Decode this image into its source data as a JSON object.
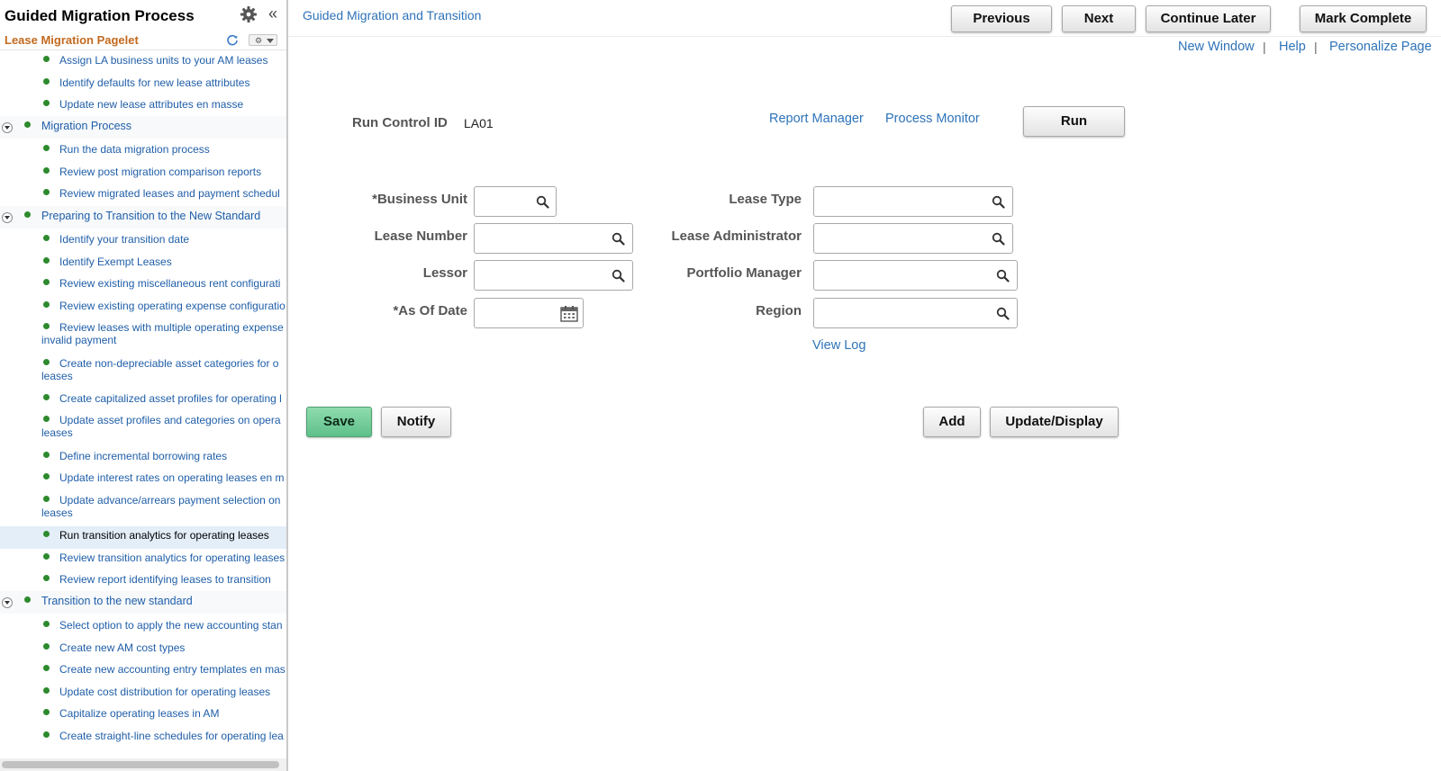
{
  "left_panel": {
    "title": "Guided Migration Process",
    "pagelet_title": "Lease Migration Pagelet",
    "steps": [
      {
        "label": "Assign LA business units to your AM leases"
      },
      {
        "label": "Identify defaults for new lease attributes"
      },
      {
        "label": "Update new lease attributes en masse"
      },
      {
        "label": "Migration Process"
      },
      {
        "label": "Run the data migration process"
      },
      {
        "label": "Review post migration comparison reports"
      },
      {
        "label": "Review migrated leases and payment schedul"
      },
      {
        "label": "Preparing to Transition to the New Standard"
      },
      {
        "label": "Identify your transition date"
      },
      {
        "label": "Identify Exempt Leases"
      },
      {
        "label": "Review existing miscellaneous rent configurati"
      },
      {
        "label": "Review existing operating expense configuratio"
      },
      {
        "label": "Review leases with multiple operating expense invalid payment"
      },
      {
        "label": "Create non-depreciable asset categories for o leases"
      },
      {
        "label": "Create capitalized asset profiles for operating l"
      },
      {
        "label": "Update asset profiles and categories on opera leases"
      },
      {
        "label": "Define incremental borrowing rates"
      },
      {
        "label": "Update interest rates on operating leases en m"
      },
      {
        "label": "Update advance/arrears payment selection on leases"
      },
      {
        "label": "Run transition analytics for operating leases"
      },
      {
        "label": "Review transition analytics for operating leases"
      },
      {
        "label": "Review report identifying leases to transition"
      },
      {
        "label": "Transition to the new standard"
      },
      {
        "label": "Select option to apply the new accounting stan"
      },
      {
        "label": "Create new AM cost types"
      },
      {
        "label": "Create new accounting entry templates en mas"
      },
      {
        "label": "Update cost distribution for operating leases"
      },
      {
        "label": "Capitalize operating leases in AM"
      },
      {
        "label": "Create straight-line schedules for operating lea"
      }
    ]
  },
  "topbar": {
    "breadcrumb": "Guided Migration and Transition",
    "previous": "Previous",
    "next": "Next",
    "continue_later": "Continue Later",
    "mark_complete": "Mark Complete",
    "new_window": "New Window",
    "help": "Help",
    "personalize": "Personalize Page",
    "sep": "|"
  },
  "form": {
    "run_control_label": "Run Control ID",
    "run_control_value": "LA01",
    "report_manager": "Report Manager",
    "process_monitor": "Process Monitor",
    "run": "Run",
    "business_unit": "*Business Unit",
    "lease_number": "Lease Number",
    "lessor": "Lessor",
    "as_of_date": "*As Of Date",
    "lease_type": "Lease Type",
    "lease_administrator": "Lease Administrator",
    "portfolio_manager": "Portfolio Manager",
    "region": "Region",
    "view_log": "View Log"
  },
  "actions": {
    "save": "Save",
    "notify": "Notify",
    "add": "Add",
    "update_display": "Update/Display"
  },
  "colors": {
    "link": "#2e73b8",
    "pagelet_title": "#c36a1f",
    "status_dot": "#2d8a2d",
    "save_button": "#6cc895"
  }
}
